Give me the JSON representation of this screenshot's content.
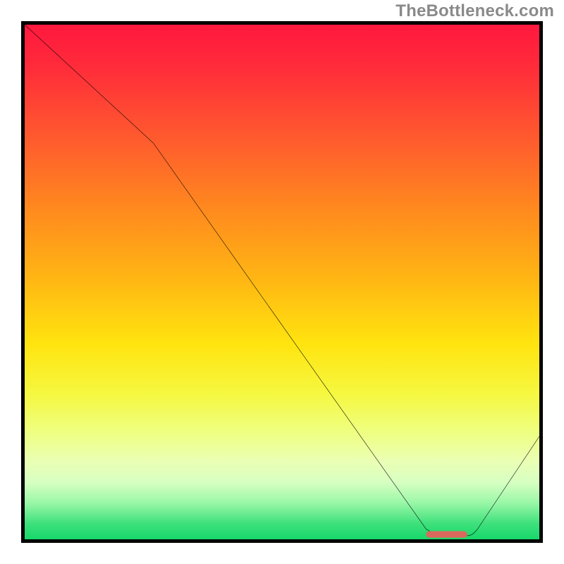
{
  "watermark": "TheBottleneck.com",
  "chart_data": {
    "type": "line",
    "title": "",
    "xlabel": "",
    "ylabel": "",
    "xlim": [
      0,
      100
    ],
    "ylim": [
      0,
      100
    ],
    "grid": false,
    "legend": "none",
    "series": [
      {
        "name": "bottleneck-curve",
        "x": [
          0,
          25,
          78,
          82,
          86,
          100
        ],
        "y": [
          100,
          77,
          2,
          0.5,
          0.5,
          20
        ],
        "note": "y in percent of plot height from bottom; visual estimate"
      }
    ],
    "annotations": [
      {
        "name": "sweet-spot-marker",
        "shape": "rounded-bar",
        "x_range": [
          78,
          86
        ],
        "y": 0.7,
        "color": "#d9695d"
      }
    ],
    "gradient_stops": [
      {
        "pos": 0,
        "color": "#ff183e"
      },
      {
        "pos": 8,
        "color": "#ff2b3a"
      },
      {
        "pos": 22,
        "color": "#ff5a2e"
      },
      {
        "pos": 36,
        "color": "#ff8a1e"
      },
      {
        "pos": 50,
        "color": "#ffb813"
      },
      {
        "pos": 62,
        "color": "#ffe40f"
      },
      {
        "pos": 72,
        "color": "#f5f842"
      },
      {
        "pos": 79,
        "color": "#efff80"
      },
      {
        "pos": 85,
        "color": "#eaffb5"
      },
      {
        "pos": 89,
        "color": "#d6ffc2"
      },
      {
        "pos": 93,
        "color": "#98f7a7"
      },
      {
        "pos": 97,
        "color": "#3de07b"
      },
      {
        "pos": 100,
        "color": "#17d86b"
      }
    ],
    "marker_color": "#d9695d",
    "curve_color": "#000000"
  }
}
